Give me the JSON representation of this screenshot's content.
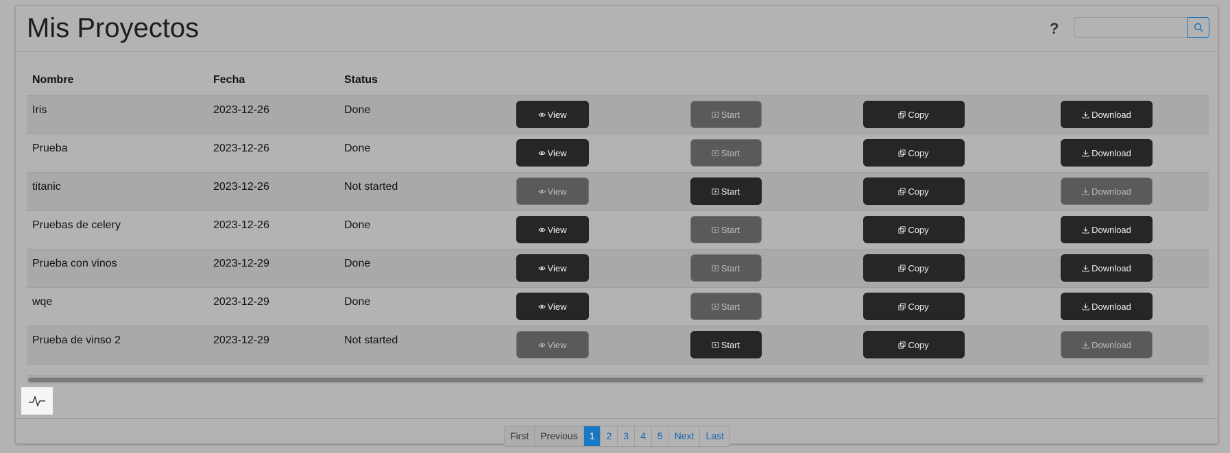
{
  "header": {
    "title": "Mis Proyectos",
    "help": "?",
    "search_placeholder": ""
  },
  "table": {
    "columns": [
      "Nombre",
      "Fecha",
      "Status"
    ],
    "buttons": {
      "view": "View",
      "start": "Start",
      "copy": "Copy",
      "download": "Download"
    },
    "rows": [
      {
        "name": "Iris",
        "date": "2023-12-26",
        "status": "Done"
      },
      {
        "name": "Prueba",
        "date": "2023-12-26",
        "status": "Done"
      },
      {
        "name": "titanic",
        "date": "2023-12-26",
        "status": "Not started"
      },
      {
        "name": "Pruebas de celery",
        "date": "2023-12-26",
        "status": "Done"
      },
      {
        "name": "Prueba con vinos",
        "date": "2023-12-29",
        "status": "Done"
      },
      {
        "name": "wqe",
        "date": "2023-12-29",
        "status": "Done"
      },
      {
        "name": "Prueba de vinso 2",
        "date": "2023-12-29",
        "status": "Not started"
      }
    ]
  },
  "pagination": {
    "first": "First",
    "previous": "Previous",
    "pages": [
      "1",
      "2",
      "3",
      "4",
      "5"
    ],
    "next": "Next",
    "last": "Last"
  },
  "icons": {
    "search": "search-icon",
    "pulse": "activity-icon",
    "view": "eye-icon",
    "start": "play-icon",
    "copy": "copy-icon",
    "download": "download-icon"
  },
  "colors": {
    "accent": "#1a78c2",
    "button": "#262626",
    "button_disabled": "#5a5a5a",
    "background": "#b3b3b3"
  }
}
